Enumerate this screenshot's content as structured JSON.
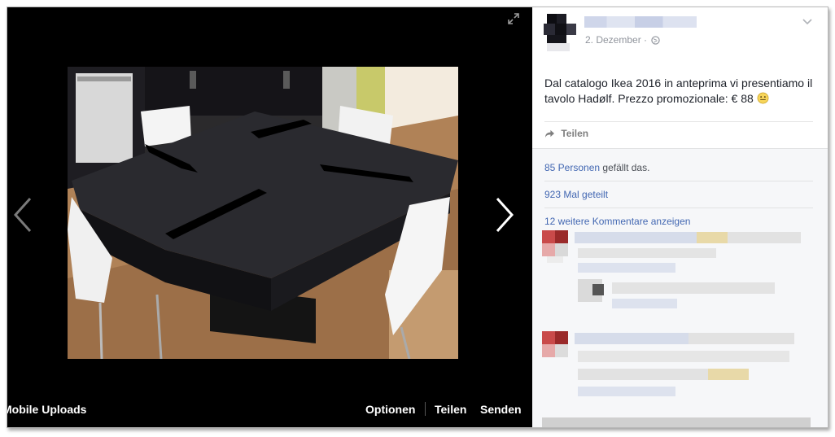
{
  "viewer": {
    "album_label": "Mobile Uploads",
    "actions": {
      "options": "Optionen",
      "share": "Teilen",
      "send": "Senden"
    },
    "icons": {
      "prev": "chevron-left-icon",
      "next": "chevron-right-icon",
      "expand": "expand-icon"
    }
  },
  "post": {
    "date": "2. Dezember",
    "separator": "·",
    "text": "Dal catalogo Ikea 2016 in anteprima vi presentiamo il tavolo Hadølf. Prezzo promozionale: € 88",
    "share_label": "Teilen"
  },
  "social": {
    "likes_count": "85 Personen",
    "likes_suffix": " gefällt das.",
    "shares": "923 Mal geteilt",
    "more_comments": "12 weitere Kommentare anzeigen"
  },
  "colors": {
    "link": "#4267b2",
    "meta": "#90949c",
    "text": "#1d2129"
  }
}
